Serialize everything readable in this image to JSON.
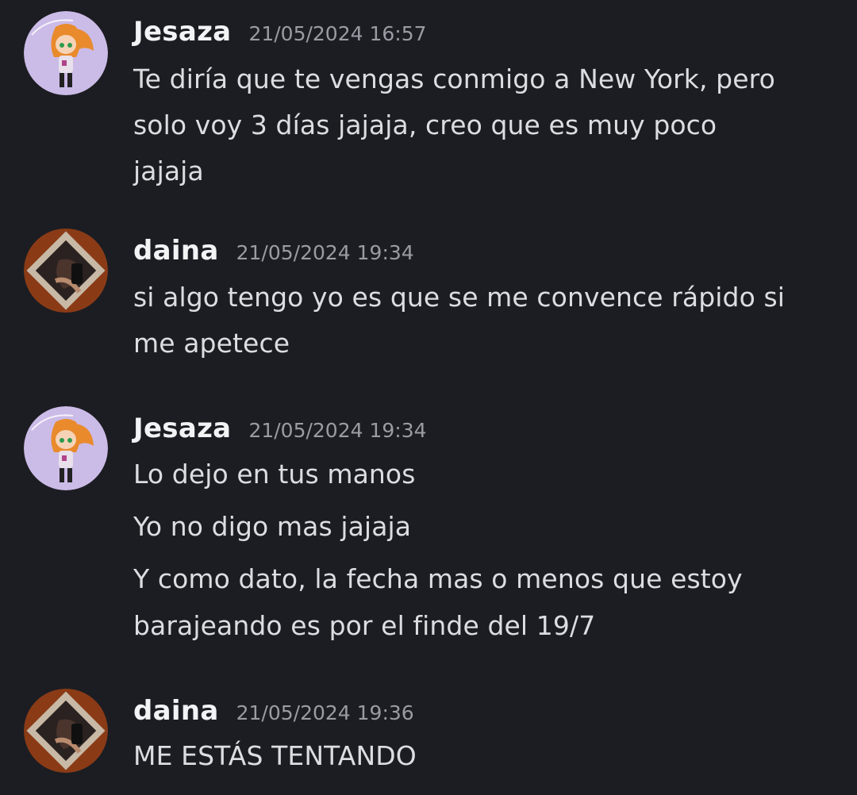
{
  "messages": [
    {
      "username": "Jesaza",
      "timestamp": "21/05/2024 16:57",
      "avatar": "cartoon-girl-avatar",
      "lines": [
        "Te diría que te vengas conmigo a New York, pero",
        "solo voy 3 días jajaja, creo que es muy poco",
        "jajaja"
      ]
    },
    {
      "username": "daina",
      "timestamp": "21/05/2024 19:34",
      "avatar": "photo-avatar",
      "lines": [
        "si algo tengo yo es que se me convence rápido si",
        "me apetece"
      ]
    },
    {
      "username": "Jesaza",
      "timestamp": "21/05/2024 19:34",
      "avatar": "cartoon-girl-avatar",
      "lines": [
        "Lo dejo en tus manos",
        "Yo no digo mas jajaja",
        "Y como dato, la fecha mas o menos que estoy",
        "barajeando es por el finde del 19/7"
      ]
    },
    {
      "username": "daina",
      "timestamp": "21/05/2024 19:36",
      "avatar": "photo-avatar",
      "lines": [
        "ME ESTÁS TENTANDO"
      ]
    }
  ],
  "colors": {
    "background": "#1c1d22",
    "username": "#f2f3f5",
    "timestamp": "#9a9ca3",
    "text": "#dcdde1",
    "avatar_jesaza_bg": "#c9b7e6",
    "avatar_daina_bg": "#8a3b16"
  }
}
